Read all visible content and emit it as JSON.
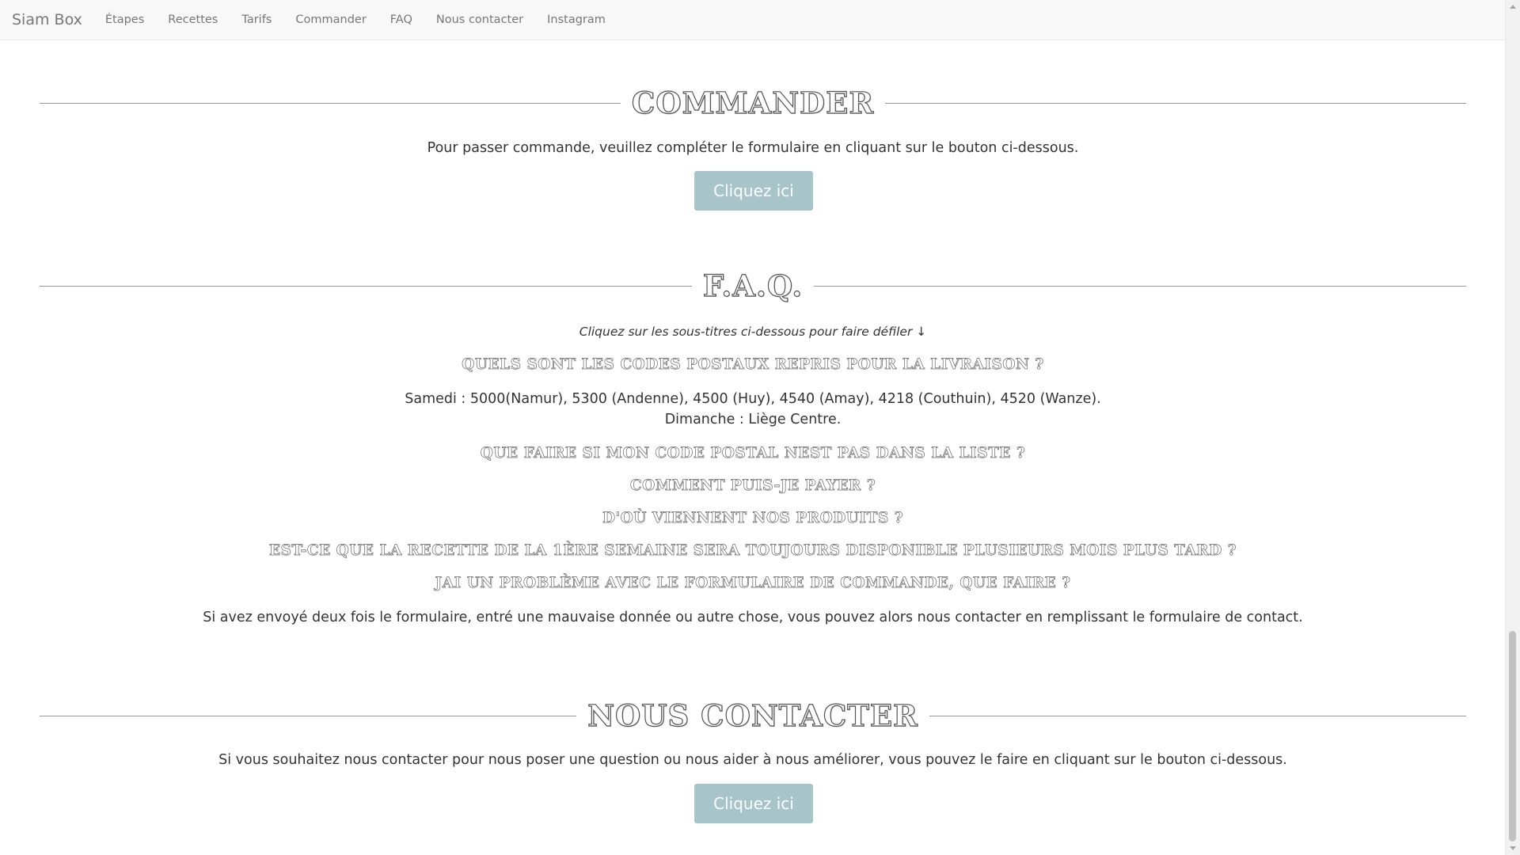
{
  "navbar": {
    "brand": "Siam Box",
    "links": [
      "Étapes",
      "Recettes",
      "Tarifs",
      "Commander",
      "FAQ",
      "Nous contacter",
      "Instagram"
    ]
  },
  "commander": {
    "title": "COMMANDER",
    "text": "Pour passer commande, veuillez compléter le formulaire en cliquant sur le bouton ci-dessous.",
    "button": "Cliquez ici"
  },
  "faq": {
    "title": "F.A.Q.",
    "hint": "Cliquez sur les sous-titres ci-dessous pour faire défiler ↓",
    "q1": "QUELS SONT LES CODES POSTAUX REPRIS POUR LA LIVRAISON ?",
    "a1_line1": "Samedi : 5000(Namur), 5300 (Andenne), 4500 (Huy), 4540 (Amay), 4218 (Couthuin), 4520 (Wanze).",
    "a1_line2": "Dimanche : Liège Centre.",
    "q2": "QUE FAIRE SI MON CODE POSTAL NEST PAS DANS LA LISTE ?",
    "q3": "COMMENT PUIS-JE PAYER ?",
    "q4": "D'OÙ VIENNENT NOS PRODUITS ?",
    "q5": "EST-CE QUE LA RECETTE DE LA 1ÈRE SEMAINE SERA TOUJOURS DISPONIBLE PLUSIEURS MOIS PLUS TARD ?",
    "q6": "JAI UN PROBLÈME AVEC LE FORMULAIRE DE COMMANDE, QUE FAIRE ?",
    "a6": "Si avez envoyé deux fois le formulaire, entré une mauvaise donnée ou autre chose, vous pouvez alors nous contacter en remplissant le formulaire de contact."
  },
  "contact": {
    "title": "NOUS CONTACTER",
    "text": "Si vous souhaitez nous contacter pour nous poser une question ou nous aider à nous améliorer, vous pouvez le faire en cliquant sur le bouton ci-dessous.",
    "button": "Cliquez ici"
  },
  "colors": {
    "button_bg": "#a7c4c9",
    "navbar_bg": "#f8f8f8",
    "text": "#333333"
  }
}
